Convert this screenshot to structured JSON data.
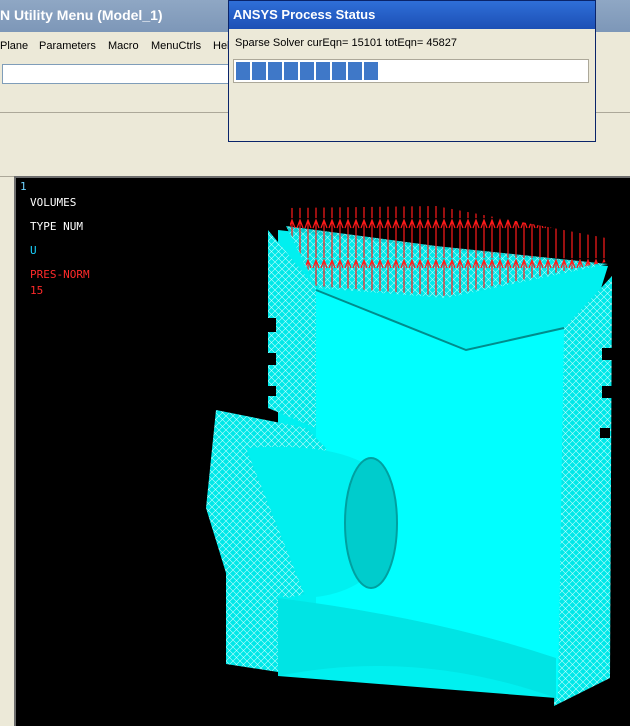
{
  "window": {
    "title": "N Utility Menu (Model_1)"
  },
  "menu": {
    "items": [
      "Plane",
      "Parameters",
      "Macro",
      "MenuCtrls",
      "Hel"
    ]
  },
  "command": {
    "value": ""
  },
  "graphics": {
    "window_number": "1",
    "legend": [
      "VOLUMES",
      "TYPE NUM",
      "U",
      "PRES-NORM",
      "15"
    ],
    "colors": {
      "background": "#000000",
      "model": "#00ffff",
      "pressure": "#ff0000",
      "text": "#ffffff"
    }
  },
  "dialog": {
    "title": "ANSYS Process Status",
    "message": "Sparse Solver  curEqn=  15101  totEqn=  45827",
    "progress": 0.41,
    "segments": 9
  }
}
